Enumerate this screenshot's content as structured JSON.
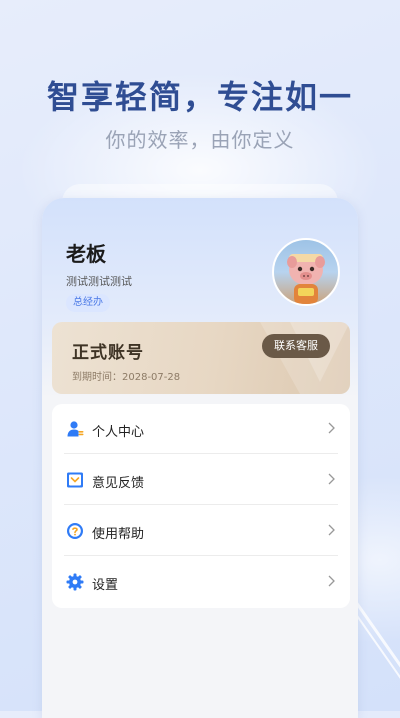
{
  "hero": {
    "title": "智享轻简，专注如一",
    "subtitle": "你的效率，由你定义"
  },
  "profile": {
    "name": "老板",
    "description": "测试测试测试",
    "role": "总经办",
    "avatar_icon": "avatar-character"
  },
  "account": {
    "title": "正式账号",
    "expire_text": "到期时间：2028-07-28",
    "contact_label": "联系客服"
  },
  "menu": {
    "items": [
      {
        "label": "个人中心",
        "icon": "person-icon"
      },
      {
        "label": "意见反馈",
        "icon": "feedback-icon"
      },
      {
        "label": "使用帮助",
        "icon": "help-icon"
      },
      {
        "label": "设置",
        "icon": "gear-icon"
      }
    ]
  },
  "colors": {
    "accent": "#2f4d93",
    "icon_blue": "#2f7bf6",
    "icon_orange": "#f5a623",
    "badge_bg": "#dbe6ff",
    "account_card": "#e7d7c3",
    "contact_button": "#6a5947"
  }
}
